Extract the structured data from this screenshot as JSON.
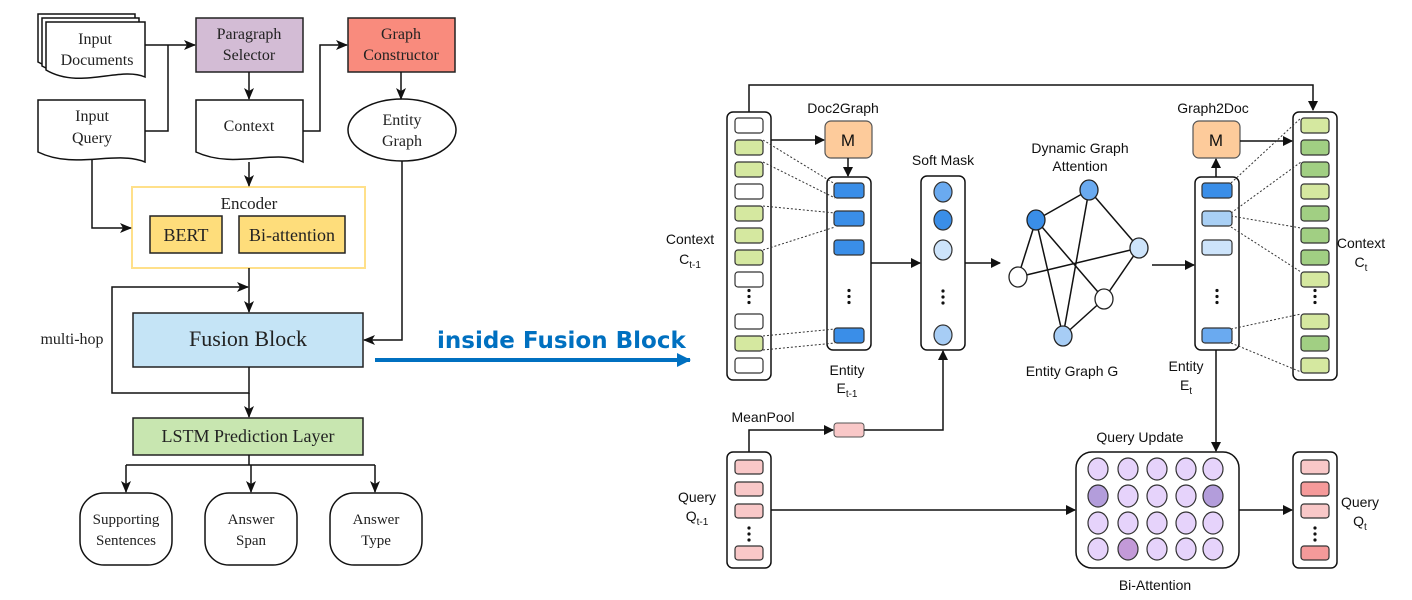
{
  "pipeline": {
    "input_documents": [
      "Input",
      "Documents"
    ],
    "input_query": [
      "Input",
      "Query"
    ],
    "paragraph_selector": [
      "Paragraph",
      "Selector"
    ],
    "graph_constructor": [
      "Graph",
      "Constructor"
    ],
    "context": "Context",
    "entity_graph": [
      "Entity",
      "Graph"
    ],
    "encoder": "Encoder",
    "bert": "BERT",
    "bi_attention": "Bi-attention",
    "fusion_block": "Fusion Block",
    "multi_hop": "multi-hop",
    "lstm": "LSTM Prediction Layer",
    "outputs": [
      [
        "Supporting",
        "Sentences"
      ],
      [
        "Answer",
        "Span"
      ],
      [
        "Answer",
        "Type"
      ]
    ]
  },
  "link_label": "inside Fusion Block",
  "fusion": {
    "context_prev": {
      "label": "Context",
      "symbol": "C",
      "sub": "t-1"
    },
    "context_next": {
      "label": "Context",
      "symbol": "C",
      "sub": "t"
    },
    "entity_prev": {
      "label": "Entity",
      "symbol": "E",
      "sub": "t-1"
    },
    "entity_next": {
      "label": "Entity",
      "symbol": "E",
      "sub": "t"
    },
    "query_prev": {
      "label": "Query",
      "symbol": "Q",
      "sub": "t-1"
    },
    "query_next": {
      "label": "Query",
      "symbol": "Q",
      "sub": "t"
    },
    "doc2graph": "Doc2Graph",
    "graph2doc": "Graph2Doc",
    "m": "M",
    "soft_mask": "Soft Mask",
    "dynamic_graph_attention": [
      "Dynamic Graph",
      "Attention"
    ],
    "entity_graph_g": "Entity Graph G",
    "mean_pool": "MeanPool",
    "query_update": "Query Update",
    "bi_attention": "Bi-Attention"
  },
  "colors": {
    "paragraph_selector": "#d3bcd5",
    "graph_constructor": "#f98b7d",
    "encoder_border": "#ffe08a",
    "encoder_block": "#fedd7b",
    "fusion_block": "#c5e4f6",
    "lstm": "#c8e6b0",
    "link": "#0070c0",
    "m_box": "#fdcb9b",
    "context_prev_cells": [
      "#ffffff",
      "#d5e8a0",
      "#d5e8a0",
      "#ffffff",
      "#d5e8a0",
      "#d5e8a0",
      "#d5e8a0",
      "#ffffff",
      "dots",
      "#ffffff",
      "#d5e8a0",
      "#ffffff"
    ],
    "context_next_cells": [
      "#d5e8a0",
      "#a1cf83",
      "#a1cf83",
      "#d5e8a0",
      "#a1cf83",
      "#a1cf83",
      "#a1cf83",
      "#d5e8a0",
      "dots",
      "#d5e8a0",
      "#a1cf83",
      "#d5e8a0"
    ],
    "entity_prev_cells": [
      "#3a8ee8",
      "#3a8ee8",
      "#3a8ee8",
      "dots",
      "#3a8ee8"
    ],
    "entity_next_cells": [
      "#3a8ee8",
      "#a9d0f5",
      "#cde4fb",
      "dots",
      "#6aaaf0"
    ],
    "soft_mask_nodes": [
      "#6aaaf0",
      "#3a8ee8",
      "#cde4fb",
      "dots",
      "#a7cdf5"
    ],
    "query_prev_cells": [
      "#f9c8c8",
      "#f9c8c8",
      "#f9c8c8",
      "dots",
      "#f9c8c8"
    ],
    "query_next_cells": [
      "#f9c8c8",
      "#f59a9a",
      "#f9c8c8",
      "dots",
      "#f59a9a"
    ],
    "mean_pool_cell": "#f9c8c8",
    "graph_nodes": [
      "#3a8ee8",
      "#6aaaf0",
      "#cde4fb",
      "#ffffff",
      "#ffffff",
      "#a7cdf5"
    ],
    "attention_grid": [
      [
        "#e6d3fb",
        "#e6d3fb",
        "#e6d3fb",
        "#e6d3fb",
        "#e6d3fb"
      ],
      [
        "#b39ddb",
        "#e6d3fb",
        "#e6d3fb",
        "#e6d3fb",
        "#b39ddb"
      ],
      [
        "#e6d3fb",
        "#e6d3fb",
        "#e6d3fb",
        "#e6d3fb",
        "#e6d3fb"
      ],
      [
        "#e6d3fb",
        "#c39ad8",
        "#e6d3fb",
        "#e6d3fb",
        "#e6d3fb"
      ]
    ]
  }
}
